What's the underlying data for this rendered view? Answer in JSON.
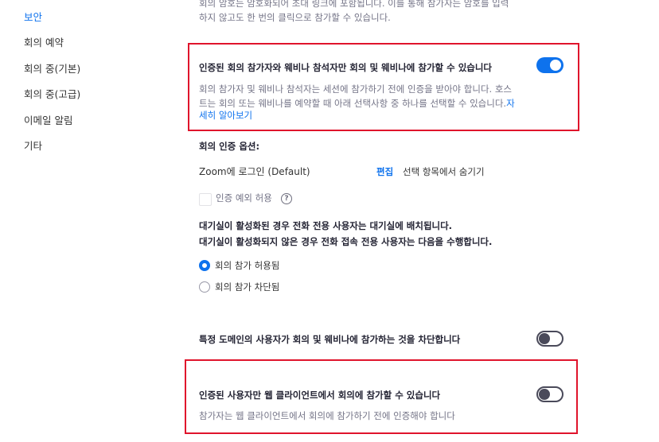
{
  "sidebar": {
    "items": [
      {
        "label": "보안",
        "active": true
      },
      {
        "label": "회의 예약",
        "active": false
      },
      {
        "label": "회의 중(기본)",
        "active": false
      },
      {
        "label": "회의 중(고급)",
        "active": false
      },
      {
        "label": "이메일 알림",
        "active": false
      },
      {
        "label": "기타",
        "active": false
      }
    ]
  },
  "passcode_desc": {
    "line1": "회의 암호는 암호화되어 초대 링크에 포함됩니다. 이를 통해 참가자는 암호를 입력",
    "line2": "하지 않고도 한 번의 클릭으로 참가할 수 있습니다."
  },
  "auth_setting": {
    "title": "인증된 회의 참가자와 웨비나 참석자만 회의 및 웨비나에 참가할 수 있습니다",
    "desc_line1": "회의 참가자 및 웨비나 참석자는 세션에 참가하기 전에 인증을 받아야 합니다. 호스",
    "desc_line2": "트는 회의 또는 웨비나를 예약할 때 아래 선택사항 중 하나를 선택할 수 있습니다.",
    "link_part1": "자",
    "link_part2": "세히 알아보기",
    "enabled": true
  },
  "auth_options": {
    "label": "회의 인증 옵션:",
    "option_name": "Zoom에 로그인 (Default)",
    "edit_label": "편집",
    "hide_label": "선택 항목에서 숨기기",
    "exception_label": "인증 예외 허용",
    "help_glyph": "?"
  },
  "waiting_room": {
    "line1": "대기실이 활성화된 경우 전화 전용 사용자는 대기실에 배치됩니다.",
    "line2": "대기실이 활성화되지 않은 경우 전화 접속 전용 사용자는 다음을 수행합니다.",
    "options": [
      {
        "label": "회의 참가 허용됨",
        "checked": true
      },
      {
        "label": "회의 참가 차단됨",
        "checked": false
      }
    ]
  },
  "block_domains": {
    "title": "특정 도메인의 사용자가 회의 및 웨비나에 참가하는 것을 차단합니다",
    "enabled": false
  },
  "web_client_auth": {
    "title": "인증된 사용자만 웹 클라이언트에서 회의에 참가할 수 있습니다",
    "desc": "참가자는 웹 클라이언트에서 회의에 참가하기 전에 인증해야 합니다",
    "enabled": false
  },
  "colors": {
    "accent": "#0e72ed",
    "highlight_box": "#e0142c",
    "toggle_off": "#4a4a5a"
  }
}
